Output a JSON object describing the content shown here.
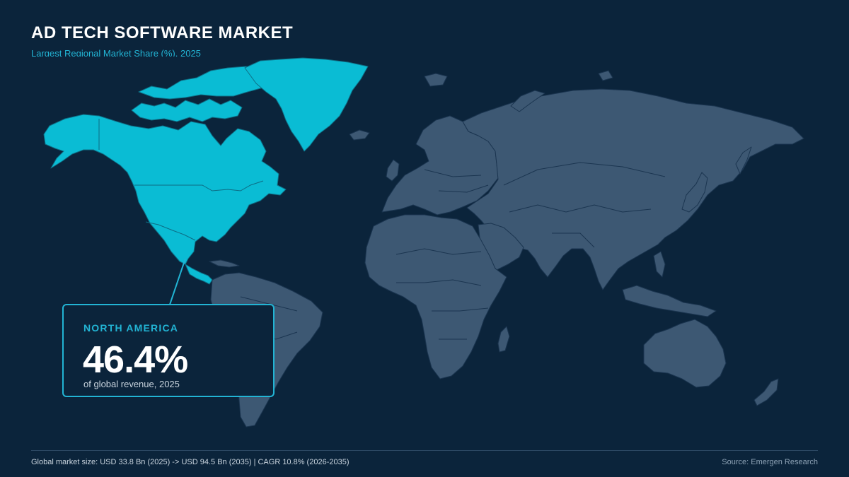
{
  "header": {
    "title": "AD TECH SOFTWARE MARKET",
    "subtitle": "Largest Regional Market Share (%), 2025"
  },
  "map": {
    "highlighted_region": "North America",
    "colors": {
      "background": "#0b243b",
      "highlight": "#0abcd4",
      "land": "#3d5873",
      "accent": "#22b4d4"
    }
  },
  "callout": {
    "region": "NORTH AMERICA",
    "value": "46.4%",
    "note": "of global revenue, 2025"
  },
  "footer": {
    "market_summary": "Global market size: USD 33.8 Bn (2025) -> USD 94.5 Bn (2035) | CAGR 10.8% (2026-2035)",
    "source": "Source: Emergen Research"
  }
}
